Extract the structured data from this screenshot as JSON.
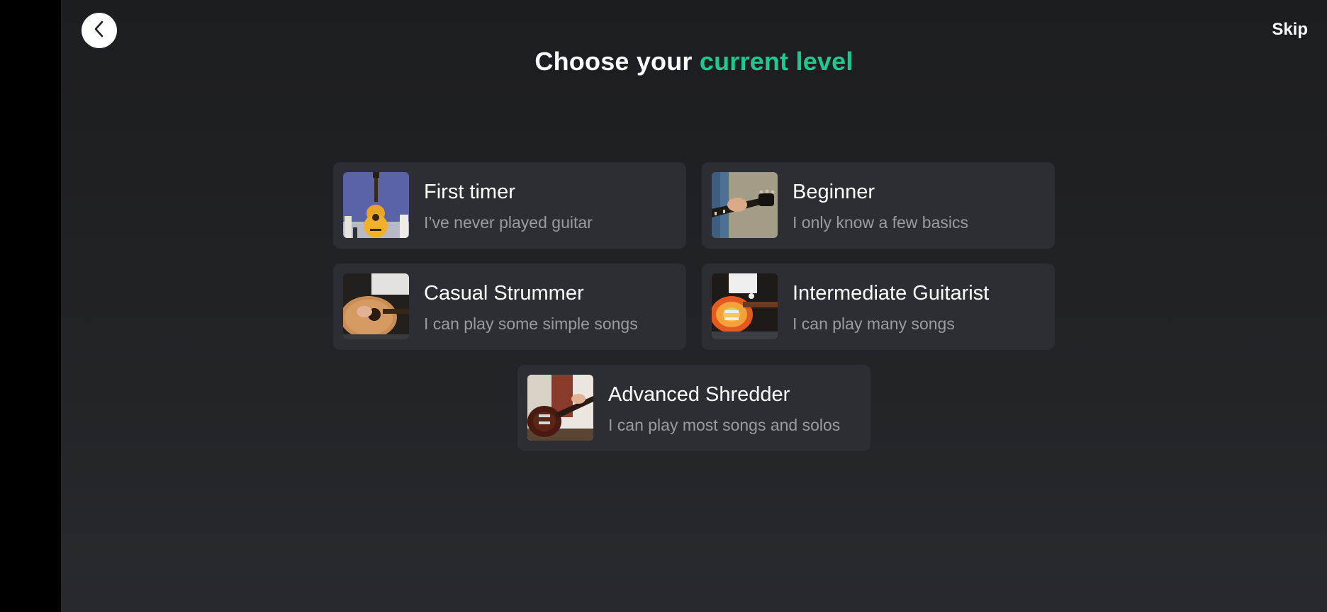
{
  "header": {
    "back_icon": "chevron-left-icon",
    "skip_label": "Skip",
    "title_prefix": "Choose your ",
    "title_accent": "current level",
    "accent_color": "#1ec98e"
  },
  "levels": [
    {
      "title": "First timer",
      "subtitle": "I’ve never played guitar",
      "image": "acoustic-guitar-on-stand"
    },
    {
      "title": "Beginner",
      "subtitle": "I only know a few basics",
      "image": "hand-holding-guitar-neck"
    },
    {
      "title": "Casual Strummer",
      "subtitle": "I can play some simple songs",
      "image": "person-strumming-acoustic"
    },
    {
      "title": "Intermediate Guitarist",
      "subtitle": "I can play many songs",
      "image": "person-playing-electric-sunburst"
    },
    {
      "title": "Advanced Shredder",
      "subtitle": "I can play most songs and solos",
      "image": "person-playing-electric-dark"
    }
  ]
}
